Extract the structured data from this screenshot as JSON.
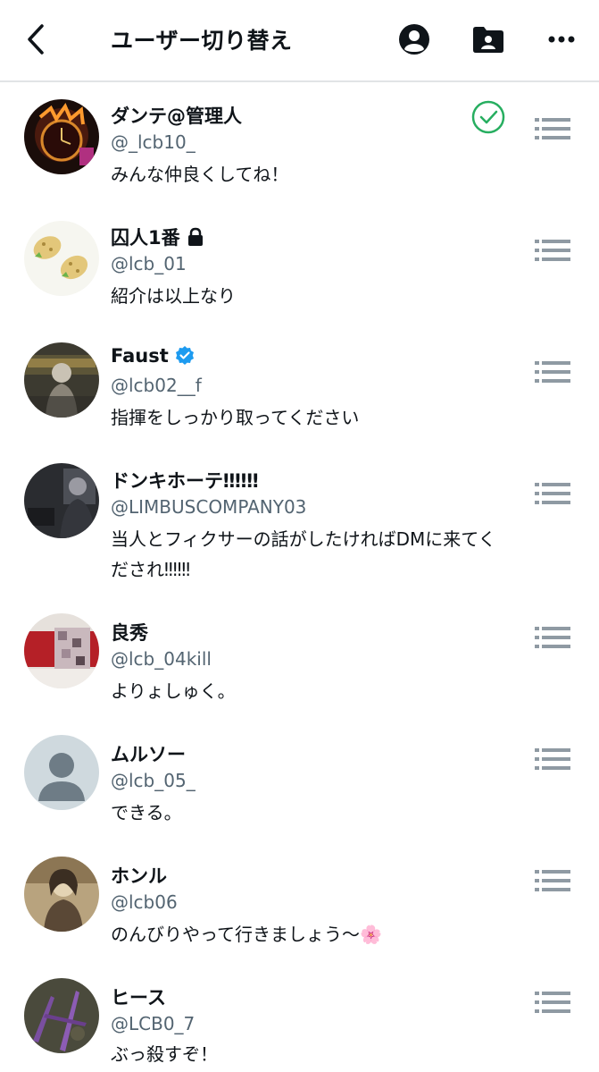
{
  "header": {
    "title": "ユーザー切り替え",
    "icons": [
      "back-icon",
      "profile-icon",
      "folder-person-icon",
      "more-icon"
    ]
  },
  "accounts": [
    {
      "name": "ダンテ@管理人",
      "handle": "@_lcb10_",
      "bio": "みんな仲良くしてね！",
      "badge": "",
      "selected": true
    },
    {
      "name": "囚人1番",
      "handle": "@lcb_01",
      "bio": "紹介は以上なり",
      "badge": "lock-icon",
      "selected": false
    },
    {
      "name": "Faust",
      "handle": "@lcb02__f",
      "bio": "指揮をしっかり取ってください",
      "badge": "verified-icon",
      "selected": false
    },
    {
      "name": "ドンキホーテ‼︎‼︎‼︎",
      "handle": "@LIMBUSCOMPANY03",
      "bio": "当人とフィクサーの話がしたければDMに来てくだされ‼︎‼︎‼︎",
      "badge": "",
      "selected": false
    },
    {
      "name": "良秀",
      "handle": "@lcb_04kill",
      "bio": "よりょしゅく。",
      "badge": "",
      "selected": false
    },
    {
      "name": "ムルソー",
      "handle": "@lcb_05_",
      "bio": "できる。",
      "badge": "",
      "selected": false
    },
    {
      "name": "ホンル",
      "handle": "@lcb06",
      "bio": "のんびりやって行きましょう〜🌸",
      "badge": "",
      "selected": false
    },
    {
      "name": "ヒース",
      "handle": "@LCB0_7",
      "bio": "ぶっ殺すぞ！",
      "badge": "",
      "selected": false
    }
  ],
  "colors": {
    "accent": "#1d9bf0",
    "check": "#27ae60",
    "handle": "#536471",
    "drag": "#8f9aa3"
  }
}
